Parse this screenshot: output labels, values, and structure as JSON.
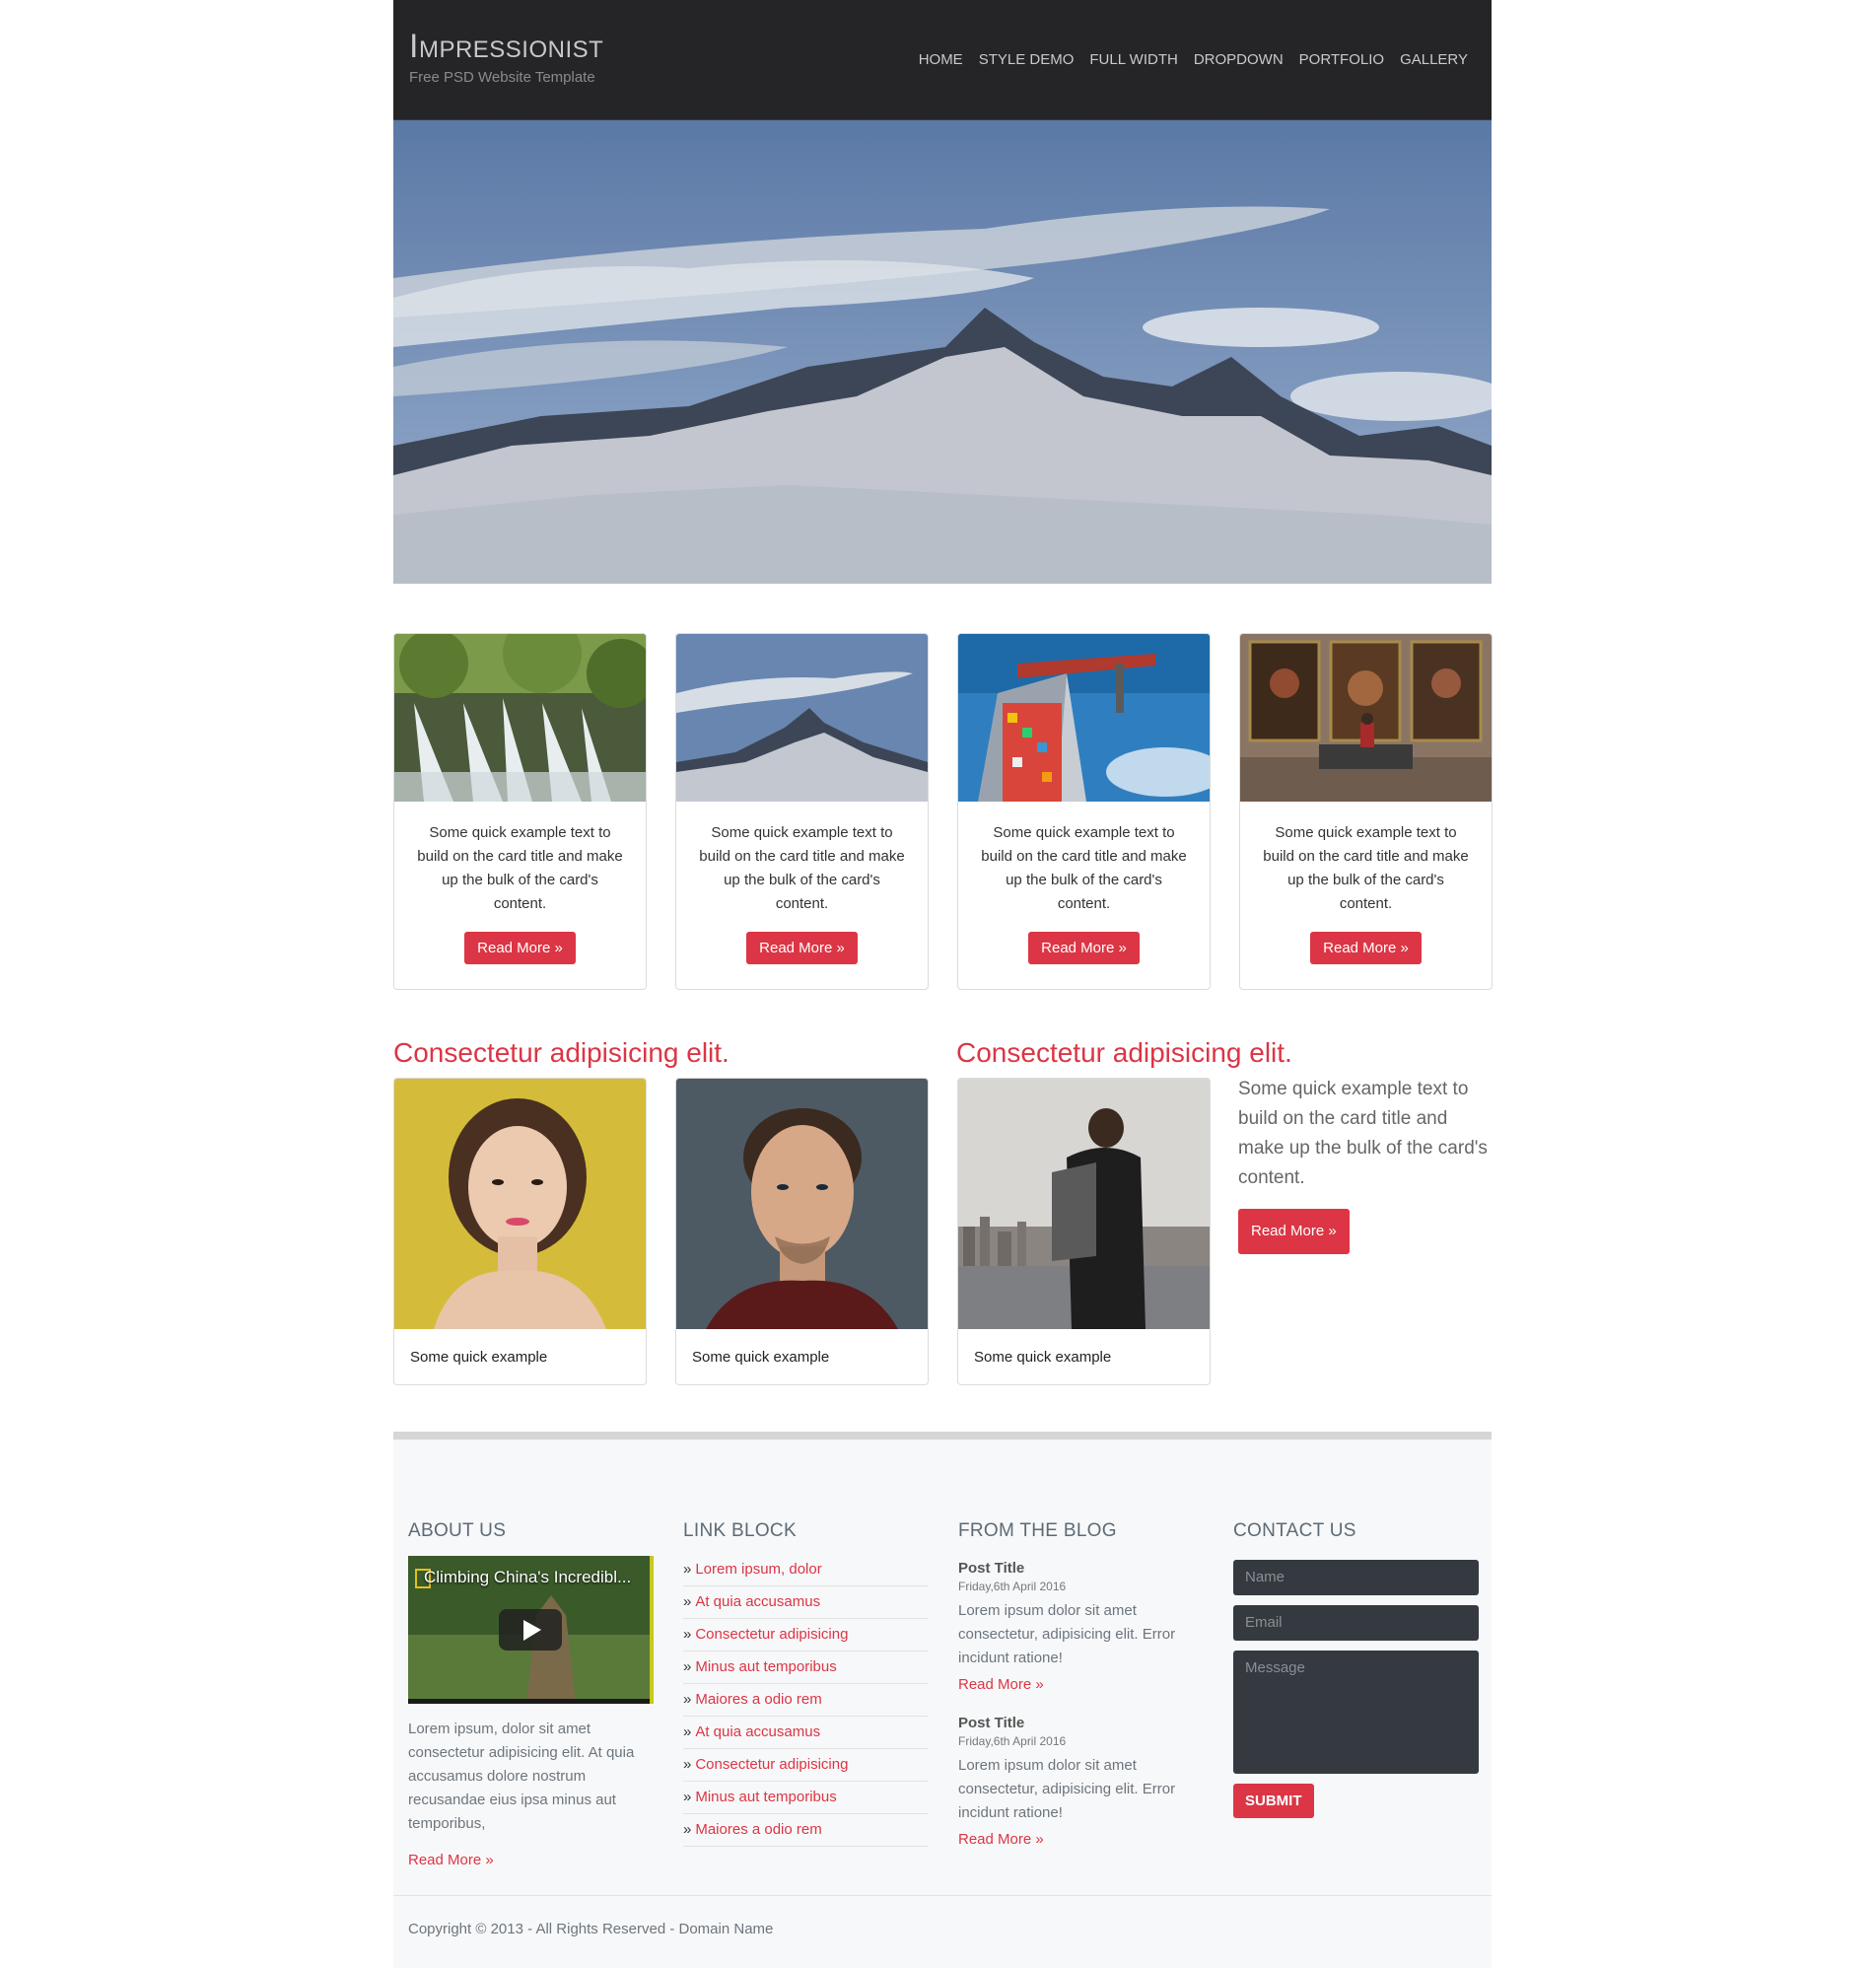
{
  "header": {
    "title": "Impressionist",
    "subtitle": "Free PSD Website Template",
    "nav": [
      "HOME",
      "STYLE DEMO",
      "FULL WIDTH",
      "DROPDOWN",
      "PORTFOLIO",
      "GALLERY"
    ]
  },
  "cards": [
    {
      "text": "Some quick example text to build on the card title and make up the bulk of the card's content.",
      "button": "Read More »"
    },
    {
      "text": "Some quick example text to build on the card title and make up the bulk of the card's content.",
      "button": "Read More »"
    },
    {
      "text": "Some quick example text to build on the card title and make up the bulk of the card's content.",
      "button": "Read More »"
    },
    {
      "text": "Some quick example text to build on the card title and make up the bulk of the card's content.",
      "button": "Read More »"
    }
  ],
  "section2": {
    "heading_left": "Consectetur adipisicing elit.",
    "heading_right": "Consectetur adipisicing elit.",
    "captions": [
      "Some quick example",
      "Some quick example",
      "Some quick example"
    ],
    "side_text": "Some quick example text to build on the card title and make up the bulk of the card's content.",
    "side_button": "Read More »"
  },
  "footer": {
    "about": {
      "heading": "ABOUT US",
      "video_title": "Climbing China's Incredibl...",
      "text": "Lorem ipsum, dolor sit amet consectetur adipisicing elit. At quia accusamus dolore nostrum recusandae eius ipsa minus aut temporibus,",
      "link": "Read More »"
    },
    "links": {
      "heading": "LINK BLOCK",
      "items": [
        "Lorem ipsum, dolor",
        "At quia accusamus",
        "Consectetur adipisicing",
        "Minus aut temporibus",
        "Maiores a odio rem",
        "At quia accusamus",
        "Consectetur adipisicing",
        "Minus aut temporibus",
        "Maiores a odio rem"
      ]
    },
    "blog": {
      "heading": "FROM THE BLOG",
      "posts": [
        {
          "title": "Post Title",
          "date": "Friday,6th April 2016",
          "text": "Lorem ipsum dolor sit amet consectetur, adipisicing elit. Error incidunt ratione!",
          "link": "Read More »"
        },
        {
          "title": "Post Title",
          "date": "Friday,6th April 2016",
          "text": "Lorem ipsum dolor sit amet consectetur, adipisicing elit. Error incidunt ratione!",
          "link": "Read More »"
        }
      ]
    },
    "contact": {
      "heading": "CONTACT US",
      "name_placeholder": "Name",
      "email_placeholder": "Email",
      "message_placeholder": "Message",
      "submit": "SUBMIT"
    },
    "copyright": "Copyright © 2013 - All Rights Reserved - Domain Name"
  },
  "colors": {
    "accent": "#dc3545",
    "header_bg": "#252527",
    "footer_bg": "#f7f8f9"
  }
}
